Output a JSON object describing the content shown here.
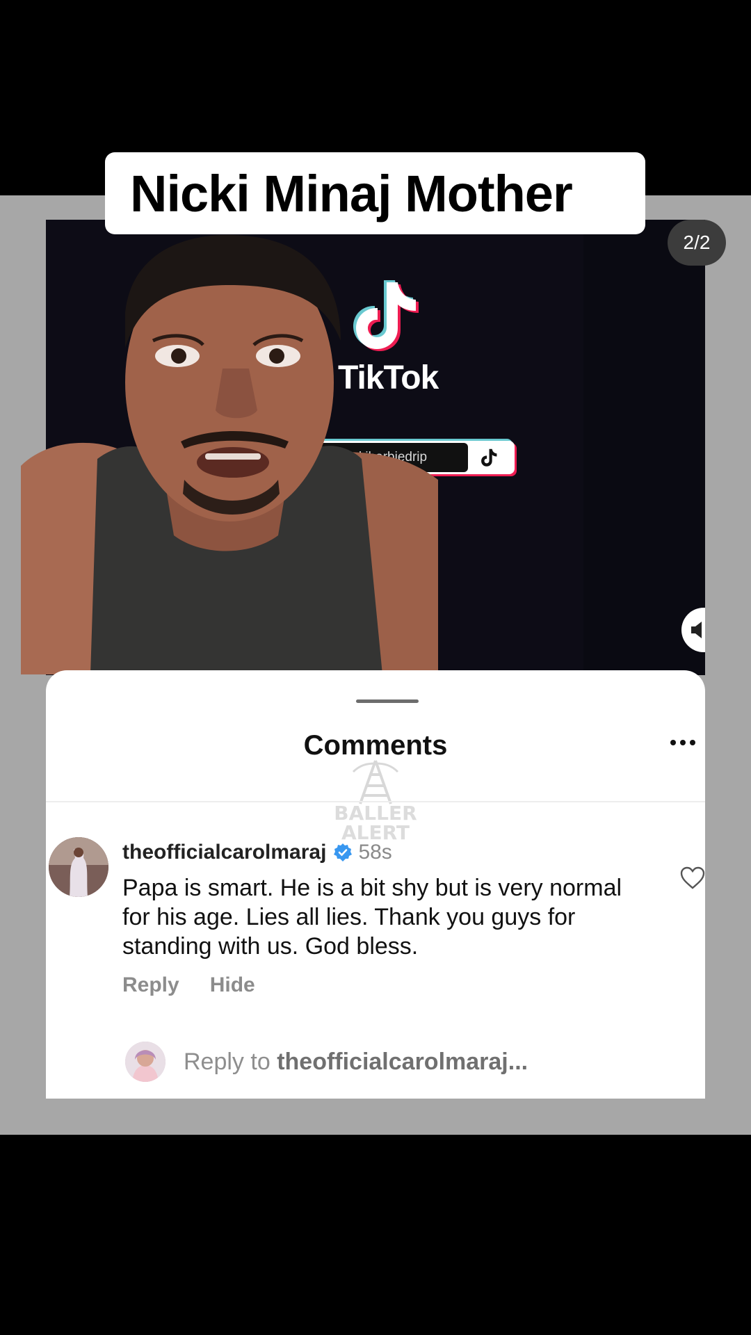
{
  "title": "Nicki Minaj Mother",
  "page_indicator": "2/2",
  "video": {
    "brand": "TikTok",
    "handle": "@ nickibarbiedrip"
  },
  "comments_sheet": {
    "title": "Comments",
    "watermark": "BALLER ALERT",
    "comment": {
      "username": "theofficialcarolmaraj",
      "time": "58s",
      "text": "Papa is smart. He is a bit shy but is very normal for his age.  Lies all lies.  Thank you guys for standing with us. God bless.",
      "reply_label": "Reply",
      "hide_label": "Hide"
    },
    "reply_prompt": "Reply to ",
    "reply_target": "theofficialcarolmaraj..."
  },
  "colors": {
    "verified": "#3897f0",
    "tiktok_cyan": "#69c9d0",
    "tiktok_pink": "#ee1d52"
  }
}
